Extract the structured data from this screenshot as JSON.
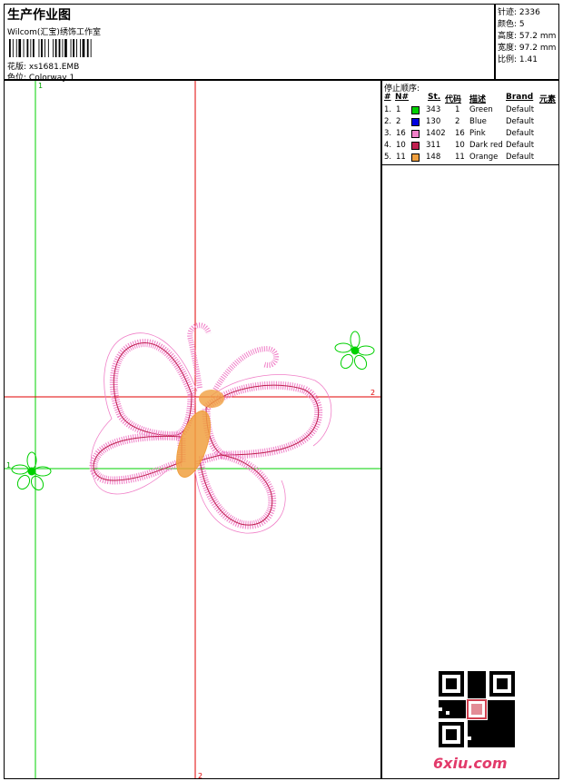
{
  "header": {
    "title": "生产作业图",
    "company": "Wilcom(汇宝)绣饰工作室",
    "design_label": "花版:",
    "design_value": "xs1681.EMB",
    "colorway_label": "色位:",
    "colorway_value": "Colorway 1"
  },
  "stats": [
    {
      "label": "针迹:",
      "value": "2336"
    },
    {
      "label": "颜色:",
      "value": "5"
    },
    {
      "label": "高度:",
      "value": "57.2 mm"
    },
    {
      "label": "宽度:",
      "value": "97.2 mm"
    },
    {
      "label": "比例:",
      "value": "1.41"
    }
  ],
  "stop_sequence": {
    "title": "停止顺序:",
    "columns": [
      "#",
      "N#",
      "St.",
      "代码",
      "描述",
      "Brand",
      "元素"
    ],
    "rows": [
      {
        "index": "1.",
        "n": "1",
        "stitches": "343",
        "code": "1",
        "desc": "Green",
        "brand": "Default",
        "color": "#00d000"
      },
      {
        "index": "2.",
        "n": "2",
        "stitches": "130",
        "code": "2",
        "desc": "Blue",
        "brand": "Default",
        "color": "#0000e0"
      },
      {
        "index": "3.",
        "n": "16",
        "stitches": "1402",
        "code": "16",
        "desc": "Pink",
        "brand": "Default",
        "color": "#f080c8"
      },
      {
        "index": "4.",
        "n": "10",
        "stitches": "311",
        "code": "10",
        "desc": "Dark red",
        "brand": "Default",
        "color": "#c02050"
      },
      {
        "index": "5.",
        "n": "11",
        "stitches": "148",
        "code": "11",
        "desc": "Orange",
        "brand": "Default",
        "color": "#f0a040"
      }
    ]
  },
  "canvas": {
    "marker_1_top": "1",
    "marker_1_left": "1",
    "marker_2_right": "2",
    "marker_2_bottom": "2",
    "colors": {
      "guide_green": "#00d000",
      "guide_red": "#e00000",
      "pink": "#f080c8",
      "orange": "#f0a040",
      "dark_red": "#c02050"
    }
  },
  "watermark": {
    "logo_text": "6xiu.com"
  }
}
